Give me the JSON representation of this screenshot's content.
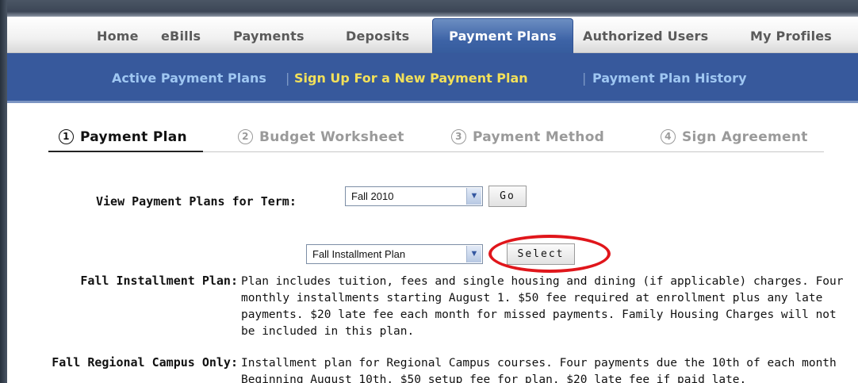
{
  "tabs": {
    "home": "Home",
    "ebills": "eBills",
    "payments": "Payments",
    "deposits": "Deposits",
    "payment_plans": "Payment Plans",
    "authorized_users": "Authorized Users",
    "my_profiles": "My Profiles"
  },
  "subnav": {
    "active": "Active Payment Plans",
    "signup": "Sign Up For a New Payment Plan",
    "history": "Payment Plan History",
    "separator": "|"
  },
  "steps": [
    {
      "num": "1",
      "label": "Payment Plan"
    },
    {
      "num": "2",
      "label": "Budget Worksheet"
    },
    {
      "num": "3",
      "label": "Payment Method"
    },
    {
      "num": "4",
      "label": "Sign Agreement"
    }
  ],
  "term": {
    "label": "View Payment Plans for Term:",
    "selected": "Fall 2010",
    "go_label": "Go"
  },
  "plan_select": {
    "selected": "Fall Installment Plan",
    "select_label": "Select"
  },
  "descriptions": [
    {
      "label": "Fall Installment Plan:",
      "text": "Plan includes tuition, fees and single housing and dining (if applicable) charges. Four monthly installments starting August 1. $50 fee required at enrollment plus any late payments. $20 late fee each month for missed payments. Family Housing Charges will not be included in this plan."
    },
    {
      "label": "Fall Regional Campus Only:",
      "text": "Installment plan for Regional Campus courses. Four payments due the 10th of each month Beginning August 10th. $50 setup fee for plan. $20 late fee if paid late."
    }
  ],
  "icons": {
    "dropdown": "chevron-down-icon",
    "step_marker": "circled-number-icon"
  },
  "colors": {
    "nav_blue": "#37599c",
    "active_tab": "#3d63a6",
    "subnav_link": "#9fc7f2",
    "subnav_current": "#f2e05a",
    "annotation_ring": "#e0161b"
  }
}
